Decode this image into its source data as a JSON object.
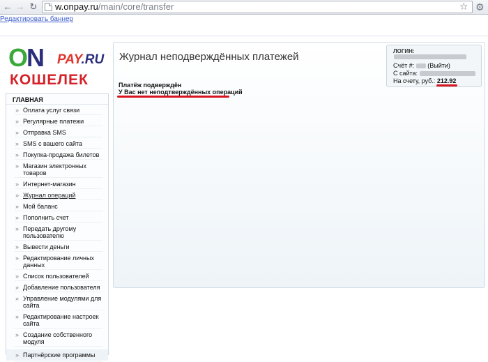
{
  "browser": {
    "url_host": "w.onpay.ru",
    "url_path": "/main/core/transfer"
  },
  "banner_link": "Редактировать баннер",
  "logo": {
    "on": "ON",
    "pay": "PAY",
    "ru": ".RU",
    "wallet": "КОШЕЛЕК"
  },
  "sidebar": {
    "heading": "ГЛАВНАЯ",
    "items": [
      {
        "label": "Оплата услуг связи"
      },
      {
        "label": "Регулярные платежи"
      },
      {
        "label": "Отправка SMS"
      },
      {
        "label": "SMS с вашего сайта"
      },
      {
        "label": "Покупка-продажа билетов"
      },
      {
        "label": "Магазин электронных товаров"
      },
      {
        "label": "Интернет-магазин"
      },
      {
        "label": "Журнал операций"
      },
      {
        "label": "Мой баланс"
      },
      {
        "label": "Пополнить счет"
      },
      {
        "label": "Передать другому пользователю"
      },
      {
        "label": "Вывести деньги"
      },
      {
        "label": "Редактирование личных данных"
      },
      {
        "label": "Список пользователей"
      },
      {
        "label": "Добавление пользователя"
      },
      {
        "label": "Управление модулями для сайта"
      },
      {
        "label": "Редактирование настроек сайта"
      },
      {
        "label": "Создание собственного модуля"
      },
      {
        "label": "Партнёрские программы"
      }
    ]
  },
  "main": {
    "title": "Журнал неподверждённых платежей",
    "message_confirmed": "Платёж подверждён",
    "message_none": "У Вас нет неподтверждённых операций"
  },
  "account": {
    "login_label": "ЛОГИН:",
    "account_label": "Счёт #:",
    "logout": "(Выйти)",
    "from_site_label": "С сайта:",
    "balance_label": "На счету, руб.:",
    "balance": "212.92"
  },
  "colors": {
    "accent_red": "#d8141e",
    "link_blue": "#3b5ccc"
  }
}
